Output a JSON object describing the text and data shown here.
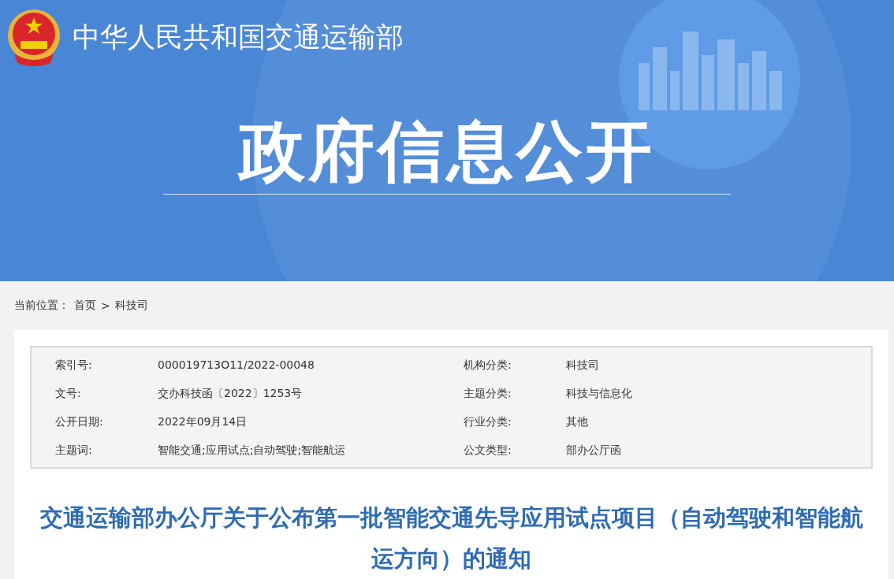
{
  "header": {
    "site_name": "中华人民共和国交通运输部",
    "banner_title": "政府信息公开"
  },
  "breadcrumb": {
    "label": "当前位置：",
    "items": [
      "首页",
      "科技司"
    ],
    "separator": ">"
  },
  "info": {
    "fields": [
      {
        "label": "索引号:",
        "value": "000019713O11/2022-00048"
      },
      {
        "label": "机构分类:",
        "value": "科技司"
      },
      {
        "label": "文号:",
        "value": "交办科技函〔2022〕1253号"
      },
      {
        "label": "主题分类:",
        "value": "科技与信息化"
      },
      {
        "label": "公开日期:",
        "value": "2022年09月14日"
      },
      {
        "label": "行业分类:",
        "value": "其他"
      },
      {
        "label": "主题词:",
        "value": "智能交通;应用试点;自动驾驶;智能航运"
      },
      {
        "label": "公文类型:",
        "value": "部办公厅函"
      }
    ]
  },
  "article": {
    "title": "交通运输部办公厅关于公布第一批智能交通先导应用试点项目（自动驾驶和智能航运方向）的通知"
  }
}
